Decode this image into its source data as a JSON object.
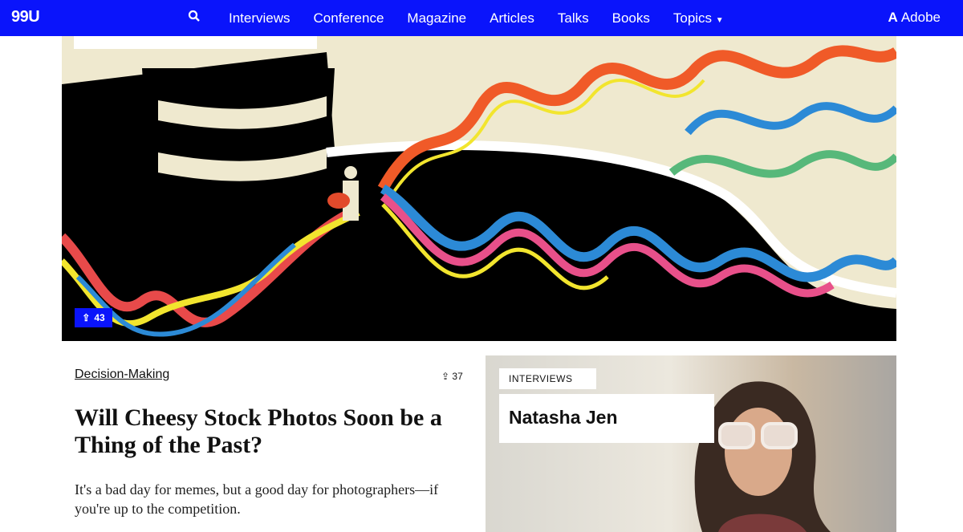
{
  "nav": {
    "logo": "99U",
    "items": [
      "Interviews",
      "Conference",
      "Magazine",
      "Articles",
      "Talks",
      "Books",
      "Topics"
    ],
    "brand": "Adobe",
    "accent": "#0a14fb"
  },
  "hero": {
    "share_count": "43"
  },
  "article": {
    "category": "Decision-Making",
    "share_count": "37",
    "title": "Will Cheesy Stock Photos Soon be a Thing of the Past?",
    "description": "It's a bad day for memes, but a good day for photographers—if you're up to the competition."
  },
  "feature": {
    "label": "INTERVIEWS",
    "name": "Natasha Jen"
  }
}
